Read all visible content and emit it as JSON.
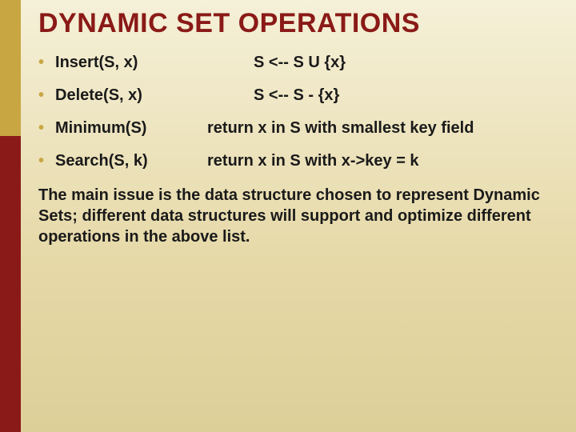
{
  "title": "DYNAMIC SET OPERATIONS",
  "ops": [
    {
      "name": "Insert(S, x)",
      "desc": "S <-- S U {x}",
      "padLeft": true
    },
    {
      "name": "Delete(S, x)",
      "desc": "S <-- S - {x}",
      "padLeft": true
    },
    {
      "name": "Minimum(S)",
      "desc": "return x in S with smallest key field",
      "padLeft": false
    },
    {
      "name": "Search(S, k)",
      "desc": "return x in S with x->key = k",
      "padLeft": false
    }
  ],
  "paragraph": "The main issue is the data structure chosen to represent Dynamic Sets; different data structures will support and optimize different operations in the above list."
}
